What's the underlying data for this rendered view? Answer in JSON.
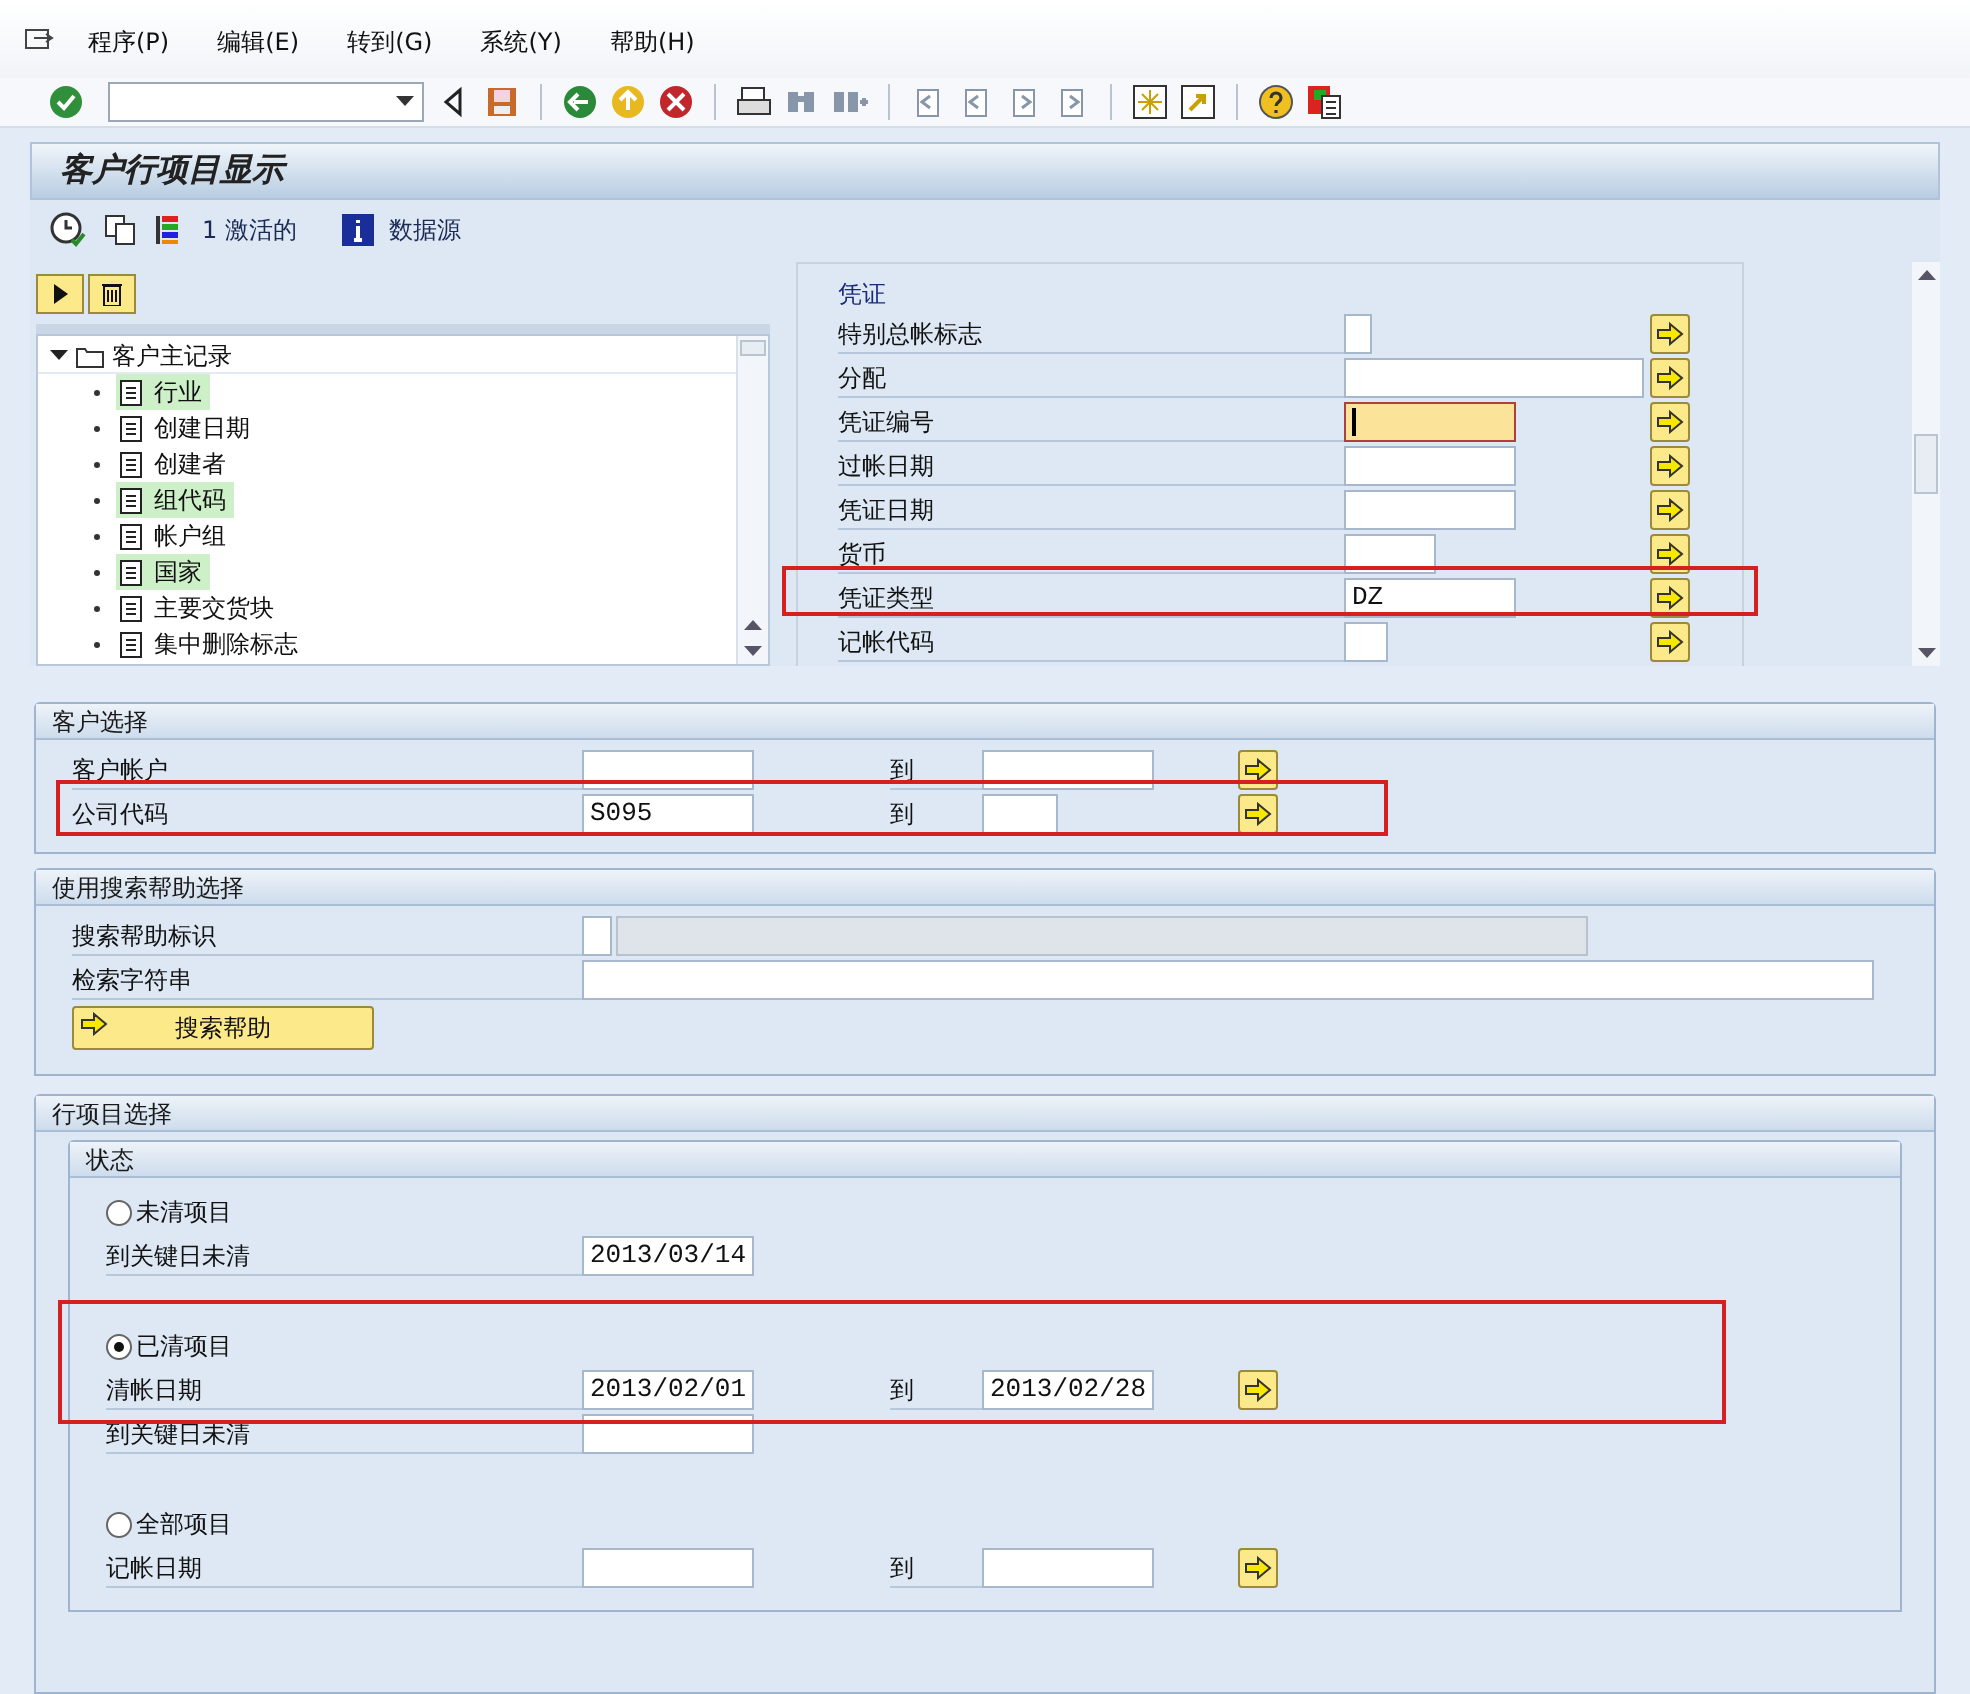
{
  "menu": [
    {
      "label": "程序(P)"
    },
    {
      "label": "编辑(E)"
    },
    {
      "label": "转到(G)"
    },
    {
      "label": "系统(Y)"
    },
    {
      "label": "帮助(H)"
    }
  ],
  "title": "客户行项目显示",
  "app_toolbar": [
    {
      "kind": "clock"
    },
    {
      "kind": "copy"
    },
    {
      "kind": "layout",
      "label": "1 激活的"
    },
    {
      "kind": "info",
      "label": "数据源"
    }
  ],
  "tree": {
    "label": "客户主记录",
    "expanded": true,
    "children": [
      {
        "label": "行业",
        "active": true
      },
      {
        "label": "创建日期",
        "active": false
      },
      {
        "label": "创建者",
        "active": false
      },
      {
        "label": "组代码",
        "active": true
      },
      {
        "label": "帐户组",
        "active": false
      },
      {
        "label": "国家",
        "active": true
      },
      {
        "label": "主要交货块",
        "active": false
      },
      {
        "label": "集中删除标志",
        "active": false
      }
    ]
  },
  "document_panel": {
    "title": "凭证",
    "fields": [
      {
        "label": "特别总帐标志",
        "focused": false,
        "highlighted": false
      },
      {
        "label": "分配",
        "focused": false,
        "highlighted": false
      },
      {
        "label": "凭证编号",
        "focused": true,
        "highlighted": false
      },
      {
        "label": "过帐日期",
        "focused": false,
        "highlighted": false
      },
      {
        "label": "凭证日期",
        "focused": false,
        "highlighted": false
      },
      {
        "label": "货币",
        "focused": false,
        "highlighted": false
      },
      {
        "label": "凭证类型",
        "value": "DZ",
        "focused": false,
        "highlighted": true
      },
      {
        "label": "记帐代码",
        "focused": false,
        "highlighted": false
      }
    ]
  },
  "customer_selection": {
    "title": "客户选择",
    "rows": [
      {
        "label": "客户帐户",
        "to_label": "到",
        "highlighted": false
      },
      {
        "label": "公司代码",
        "from": "S095",
        "to_label": "到",
        "highlighted": true
      }
    ]
  },
  "search_help": {
    "title": "使用搜索帮助选择",
    "rows": [
      {
        "label": "搜索帮助标识",
        "kind": "id"
      },
      {
        "label": "检索字符串",
        "kind": "string"
      }
    ],
    "button": "搜索帮助"
  },
  "line_item_selection": {
    "title": "行项目选择",
    "status": {
      "title": "状态",
      "options": [
        {
          "label": "未清项目",
          "selected": false,
          "highlighted": false,
          "rows": [
            {
              "label": "到关键日未清",
              "from": "2013/03/14"
            }
          ]
        },
        {
          "label": "已清项目",
          "selected": true,
          "highlighted": true,
          "rows": [
            {
              "label": "清帐日期",
              "from": "2013/02/01",
              "to_label": "到",
              "to": "2013/02/28"
            },
            {
              "label": "到关键日未清"
            }
          ]
        },
        {
          "label": "全部项目",
          "selected": false,
          "highlighted": false,
          "rows": [
            {
              "label": "记帐日期",
              "to_label": "到"
            }
          ]
        }
      ]
    }
  }
}
